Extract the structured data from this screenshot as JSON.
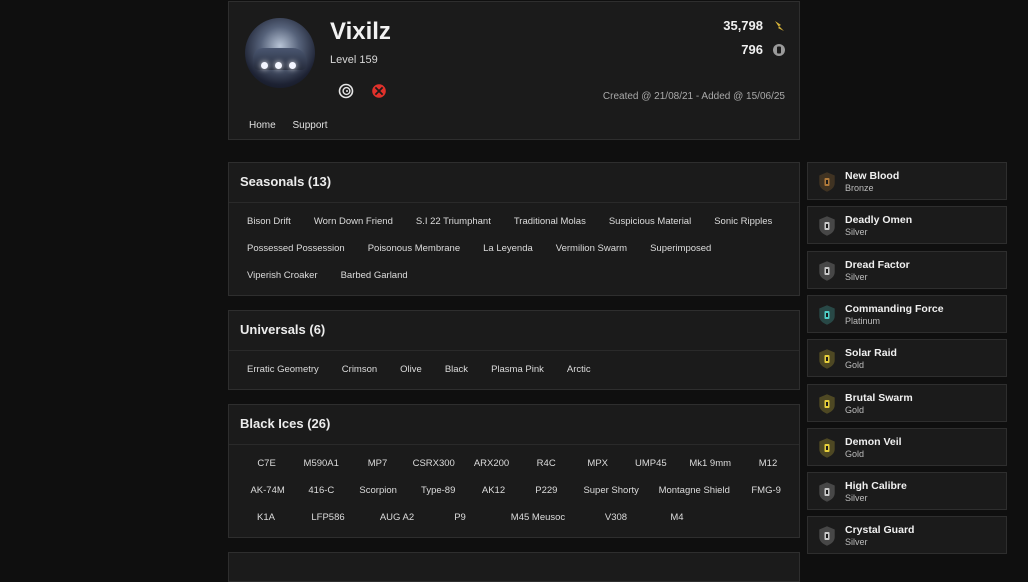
{
  "profile": {
    "username": "Vixilz",
    "level": "Level 159",
    "stat_primary": "35,798",
    "stat_secondary": "796",
    "dates": "Created @ 21/08/21 - Added @ 15/06/25",
    "platforms": [
      "ubisoft-icon",
      "xbox-icon"
    ],
    "nav": [
      "Home",
      "Support"
    ],
    "colors": {
      "coin": "#d8b43a",
      "xbox": "#e0312b"
    }
  },
  "seasonals": {
    "title": "Seasonals (13)",
    "rows": [
      [
        "Bison Drift",
        "Worn Down Friend",
        "S.I 22 Triumphant",
        "Traditional Molas",
        "Suspicious Material",
        "Sonic Ripples"
      ],
      [
        "Possessed Possession",
        "Poisonous Membrane",
        "La Leyenda",
        "Vermilion Swarm",
        "Superimposed"
      ],
      [
        "Viperish Croaker",
        "Barbed Garland"
      ]
    ]
  },
  "universals": {
    "title": "Universals (6)",
    "rows": [
      [
        "Erratic Geometry",
        "Crimson",
        "Olive",
        "Black",
        "Plasma Pink",
        "Arctic"
      ]
    ]
  },
  "black_ices": {
    "title": "Black Ices (26)",
    "rows": [
      [
        "C7E",
        "M590A1",
        "MP7",
        "CSRX300",
        "ARX200",
        "R4C",
        "MPX",
        "UMP45",
        "Mk1 9mm",
        "M12"
      ],
      [
        "AK-74M",
        "416-C",
        "Scorpion",
        "Type-89",
        "AK12",
        "P229",
        "Super Shorty",
        "Montagne Shield",
        "FMG-9"
      ],
      [
        "K1A",
        "LFP586",
        "AUG A2",
        "P9",
        "M45 Meusoc",
        "V308",
        "M4"
      ]
    ]
  },
  "charms": [
    {
      "name": "New Blood",
      "tier": "Bronze",
      "color": "#b07a3a"
    },
    {
      "name": "Deadly Omen",
      "tier": "Silver",
      "color": "#c9c9c9"
    },
    {
      "name": "Dread Factor",
      "tier": "Silver",
      "color": "#c9c9c9"
    },
    {
      "name": "Commanding Force",
      "tier": "Platinum",
      "color": "#4fd0c8"
    },
    {
      "name": "Solar Raid",
      "tier": "Gold",
      "color": "#e6cf3c"
    },
    {
      "name": "Brutal Swarm",
      "tier": "Gold",
      "color": "#e6cf3c"
    },
    {
      "name": "Demon Veil",
      "tier": "Gold",
      "color": "#e6cf3c"
    },
    {
      "name": "High Calibre",
      "tier": "Silver",
      "color": "#c9c9c9"
    },
    {
      "name": "Crystal Guard",
      "tier": "Silver",
      "color": "#c9c9c9"
    }
  ]
}
